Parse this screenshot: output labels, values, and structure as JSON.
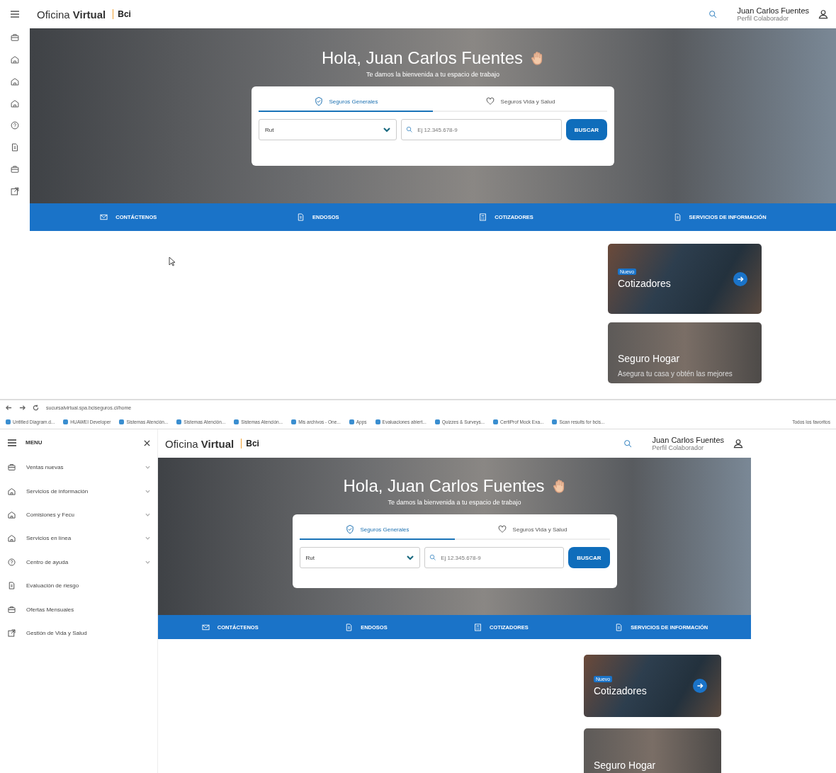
{
  "top_view": {
    "header": {
      "brand_light": "Oficina",
      "brand_bold": "Virtual",
      "logo": "Bci",
      "user_name": "Juan Carlos Fuentes",
      "user_role": "Perfil Colaborador"
    },
    "hero": {
      "greeting": "Hola, Juan Carlos Fuentes",
      "subtitle": "Te damos la bienvenida a tu espacio de trabajo"
    },
    "search": {
      "tabs": [
        {
          "label": "Seguros Generales",
          "selected": true
        },
        {
          "label": "Seguros Vida y Salud",
          "selected": false
        }
      ],
      "select_value": "Rut",
      "placeholder": "Ej 12.345.678-9",
      "button": "BUSCAR"
    },
    "quick_links": [
      {
        "label": "CONTÁCTENOS"
      },
      {
        "label": "ENDOSOS"
      },
      {
        "label": "COTIZADORES"
      },
      {
        "label": "SERVICIOS DE INFORMACIÓN"
      }
    ],
    "cards": [
      {
        "kind": "car",
        "badge": "Nuevo",
        "title": "Cotizadores"
      },
      {
        "kind": "people",
        "title": "Seguro Hogar",
        "description": "Asegura tu casa y obtén las mejores"
      }
    ]
  },
  "bottom_view": {
    "browser": {
      "url": "sucursalvirtual.spa.bciseguros.cl/home",
      "bookmarks": [
        "Untitled Diagram.d...",
        "HUAWEI Developer",
        "Sistemas Atención...",
        "Sistemas Atención...",
        "Sistemas Atención...",
        "Mis archivos - One...",
        "Apps",
        "Evaluaciones abiert...",
        "Quizzes & Surveys...",
        "CertiProf Mock Exa...",
        "Scan results for bcis..."
      ],
      "all_bookmarks": "Todos los favoritos"
    },
    "menu": {
      "title": "MENU",
      "items": [
        {
          "label": "Ventas nuevas",
          "expandable": true
        },
        {
          "label": "Servicios de información",
          "expandable": true
        },
        {
          "label": "Comisiones y Fecu",
          "expandable": true
        },
        {
          "label": "Servicios en línea",
          "expandable": true
        },
        {
          "label": "Centro de ayuda",
          "expandable": true
        },
        {
          "label": "Evaluación de riesgo",
          "expandable": false
        },
        {
          "label": "Ofertas Mensuales",
          "expandable": false
        },
        {
          "label": "Gestión de Vida y Salud",
          "expandable": false
        }
      ]
    },
    "header": {
      "brand_light": "Oficina",
      "brand_bold": "Virtual",
      "logo": "Bci",
      "user_name": "Juan Carlos Fuentes",
      "user_role": "Perfil Colaborador"
    },
    "hero": {
      "greeting": "Hola, Juan Carlos Fuentes",
      "subtitle": "Te damos la bienvenida a tu espacio de trabajo"
    },
    "search": {
      "tabs": [
        {
          "label": "Seguros Generales",
          "selected": true
        },
        {
          "label": "Seguros Vida y Salud",
          "selected": false
        }
      ],
      "select_value": "Rut",
      "placeholder": "Ej 12.345.678-9",
      "button": "BUSCAR"
    },
    "quick_links": [
      {
        "label": "CONTÁCTENOS"
      },
      {
        "label": "ENDOSOS"
      },
      {
        "label": "COTIZADORES"
      },
      {
        "label": "SERVICIOS DE INFORMACIÓN"
      }
    ],
    "cards": [
      {
        "kind": "car",
        "badge": "Nuevo",
        "title": "Cotizadores"
      },
      {
        "kind": "people",
        "title": "Seguro Hogar"
      }
    ]
  }
}
